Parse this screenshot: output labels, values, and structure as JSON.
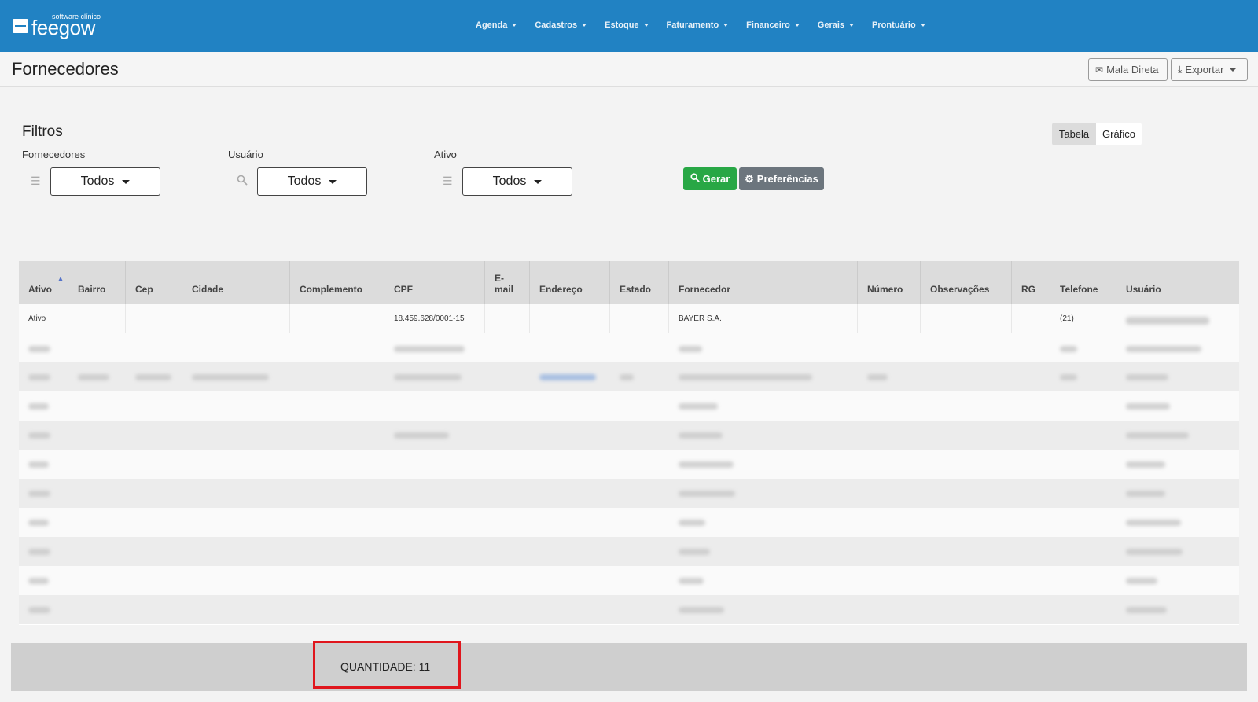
{
  "app": {
    "logo_sub": "software clínico",
    "logo_text": "feegow"
  },
  "nav": {
    "items": [
      "Agenda",
      "Cadastros",
      "Estoque",
      "Faturamento",
      "Financeiro",
      "Gerais",
      "Prontuário"
    ]
  },
  "header": {
    "title": "Fornecedores",
    "mail_label": "Mala Direta",
    "export_label": "Exportar"
  },
  "filters": {
    "title": "Filtros",
    "fornecedores_label": "Fornecedores",
    "fornecedores_value": "Todos",
    "usuario_label": "Usuário",
    "usuario_value": "Todos",
    "ativo_label": "Ativo",
    "ativo_value": "Todos",
    "gerar_label": "Gerar",
    "pref_label": "Preferências"
  },
  "view_toggle": {
    "tabela": "Tabela",
    "grafico": "Gráfico",
    "active": "Tabela"
  },
  "table": {
    "columns": [
      "Ativo",
      "Bairro",
      "Cep",
      "Cidade",
      "Complemento",
      "CPF",
      "E-mail",
      "Endereço",
      "Estado",
      "Fornecedor",
      "Número",
      "Observações",
      "RG",
      "Telefone",
      "Usuário"
    ],
    "first_row": {
      "ativo": "Ativo",
      "cpf": "18.459.628/0001-15",
      "fornecedor": "BAYER S.A.",
      "telefone": "(21)"
    }
  },
  "footer": {
    "quantidade": "QUANTIDADE: 11"
  },
  "colors": {
    "nav_bg": "#2182c3",
    "gerar_bg": "#28a745",
    "pref_bg": "#6c757d",
    "highlight_border": "#e0161d"
  }
}
